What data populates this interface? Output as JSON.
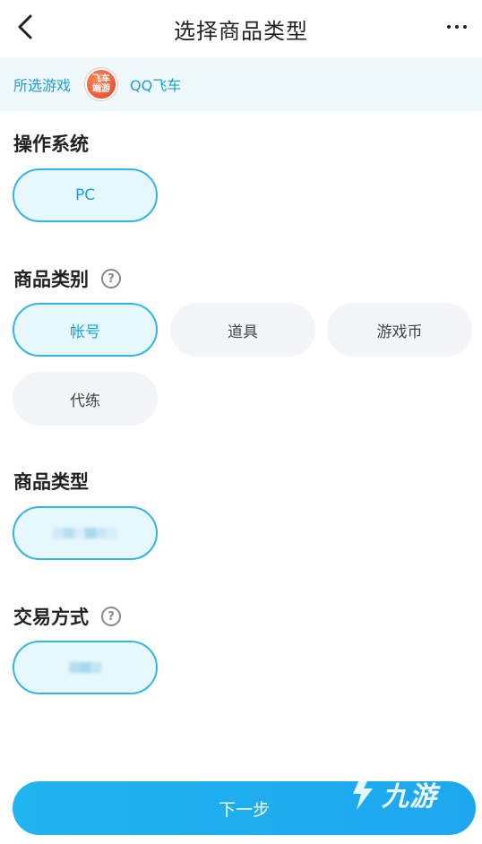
{
  "header": {
    "title": "选择商品类型"
  },
  "game": {
    "label": "所选游戏",
    "logo_text_line1": "飞车",
    "logo_text_line2": "端游",
    "name": "QQ飞车"
  },
  "os": {
    "title": "操作系统",
    "options": [
      "PC"
    ],
    "selected": "PC"
  },
  "category": {
    "title": "商品类别",
    "help": "?",
    "options": [
      "帐号",
      "道具",
      "游戏币",
      "代练"
    ],
    "selected": "帐号"
  },
  "product_type": {
    "title": "商品类型"
  },
  "trade": {
    "title": "交易方式",
    "help": "?"
  },
  "footer": {
    "next_label": "下一步"
  },
  "watermark": {
    "text": "九游"
  },
  "colors": {
    "accent": "#1aa0d8",
    "selected_border": "#33b5e5",
    "selected_bg": "#e6f7fd",
    "button": "#1ea7ee"
  }
}
